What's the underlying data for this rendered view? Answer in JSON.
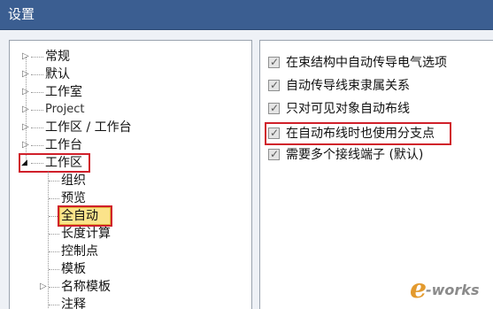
{
  "window": {
    "title": "设置"
  },
  "tree": {
    "nodes": [
      {
        "label": "常规",
        "expander": "▷"
      },
      {
        "label": "默认",
        "expander": "▷"
      },
      {
        "label": "工作室",
        "expander": "▷"
      },
      {
        "label": "Project",
        "expander": "▷"
      },
      {
        "label": "工作区 / 工作台",
        "expander": "▷"
      },
      {
        "label": "工作台",
        "expander": "▷"
      },
      {
        "label": "工作区",
        "expander": "◢"
      },
      {
        "label": "组织"
      },
      {
        "label": "预览"
      },
      {
        "label": "全自动"
      },
      {
        "label": "长度计算"
      },
      {
        "label": "控制点"
      },
      {
        "label": "模板"
      },
      {
        "label": "名称模板",
        "expander": "▷"
      },
      {
        "label": "注释"
      }
    ]
  },
  "options": {
    "items": [
      {
        "label": "在束结构中自动传导电气选项",
        "checked": true
      },
      {
        "label": "自动传导线束隶属关系",
        "checked": true
      },
      {
        "label": "只对可见对象自动布线",
        "checked": true
      },
      {
        "label": "在自动布线时也使用分支点",
        "checked": true
      },
      {
        "label": "需要多个接线端子 (默认)",
        "checked": true
      }
    ]
  },
  "watermark": {
    "letter": "e",
    "text": "-works"
  },
  "colors": {
    "titlebar": "#3b5e91",
    "highlight_border": "#d0202a",
    "selected_background": "#fbe38a",
    "watermark_orange": "#e39a2e"
  }
}
